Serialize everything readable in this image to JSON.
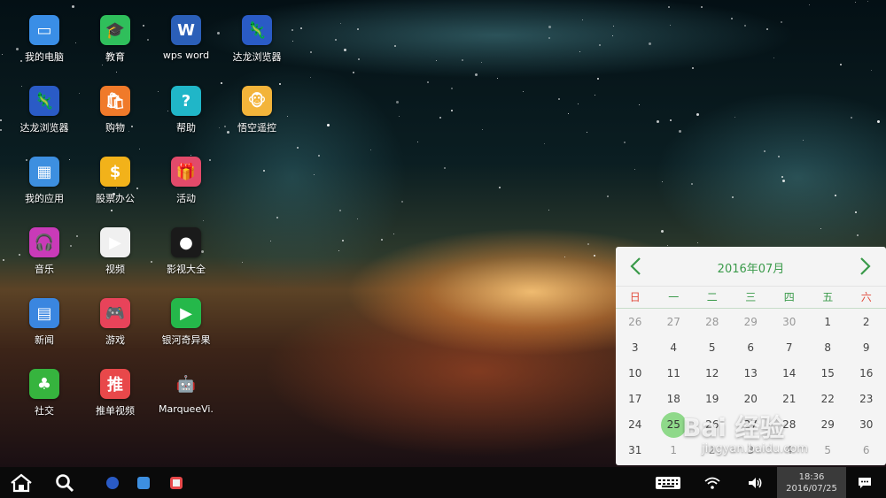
{
  "desktop": {
    "apps": [
      {
        "label": "我的电脑",
        "icon": "computer-icon",
        "color": "#3a8ee6",
        "glyph": "▭"
      },
      {
        "label": "教育",
        "icon": "graduation-cap-icon",
        "color": "#2fbf5b",
        "glyph": "🎓"
      },
      {
        "label": "wps word",
        "icon": "word-document-icon",
        "color": "#2b5fb8",
        "glyph": "W"
      },
      {
        "label": "达龙浏览器",
        "icon": "dalong-browser-icon",
        "color": "#2a5bc6",
        "glyph": "🦎"
      },
      {
        "label": "达龙浏览器",
        "icon": "dalong-browser-icon",
        "color": "#2a5bc6",
        "glyph": "🦎"
      },
      {
        "label": "购物",
        "icon": "shopping-bag-icon",
        "color": "#f07a2a",
        "glyph": "🛍"
      },
      {
        "label": "帮助",
        "icon": "help-icon",
        "color": "#20b6c8",
        "glyph": "?"
      },
      {
        "label": "悟空遥控",
        "icon": "monkey-remote-icon",
        "color": "#f3b43a",
        "glyph": "🐵"
      },
      {
        "label": "我的应用",
        "icon": "apps-grid-icon",
        "color": "#3d8fe0",
        "glyph": "▦"
      },
      {
        "label": "股票办公",
        "icon": "stock-coin-icon",
        "color": "#f2b21a",
        "glyph": "$"
      },
      {
        "label": "活动",
        "icon": "gift-icon",
        "color": "#e24a6a",
        "glyph": "🎁"
      },
      {
        "label": "",
        "icon": "blank-icon",
        "color": "transparent",
        "glyph": ""
      },
      {
        "label": "音乐",
        "icon": "music-icon",
        "color": "#c93ab8",
        "glyph": "🎧"
      },
      {
        "label": "视频",
        "icon": "video-play-icon",
        "color": "#f0f0f0",
        "glyph": "▶"
      },
      {
        "label": "影视大全",
        "icon": "movie-icon",
        "color": "#1a1a1a",
        "glyph": "●"
      },
      {
        "label": "",
        "icon": "blank-icon",
        "color": "transparent",
        "glyph": ""
      },
      {
        "label": "新闻",
        "icon": "news-icon",
        "color": "#3a86e0",
        "glyph": "▤"
      },
      {
        "label": "游戏",
        "icon": "gamepad-icon",
        "color": "#e8435a",
        "glyph": "🎮"
      },
      {
        "label": "银河奇异果",
        "icon": "tv-kiwi-icon",
        "color": "#25b84a",
        "glyph": "▶"
      },
      {
        "label": "",
        "icon": "blank-icon",
        "color": "transparent",
        "glyph": ""
      },
      {
        "label": "社交",
        "icon": "social-icon",
        "color": "#36b43e",
        "glyph": "♣"
      },
      {
        "label": "推单视频",
        "icon": "red-video-icon",
        "color": "#e8484a",
        "glyph": "推"
      },
      {
        "label": "MarqueeVi.",
        "icon": "android-icon",
        "color": "transparent",
        "glyph": "🤖"
      }
    ]
  },
  "calendar": {
    "title": "2016年07月",
    "weekdays": [
      "日",
      "一",
      "二",
      "三",
      "四",
      "五",
      "六"
    ],
    "weeks": [
      [
        "26",
        "27",
        "28",
        "29",
        "30",
        "1",
        "2"
      ],
      [
        "3",
        "4",
        "5",
        "6",
        "7",
        "8",
        "9"
      ],
      [
        "10",
        "11",
        "12",
        "13",
        "14",
        "15",
        "16"
      ],
      [
        "17",
        "18",
        "19",
        "20",
        "21",
        "22",
        "23"
      ],
      [
        "24",
        "25",
        "26",
        "27",
        "28",
        "29",
        "30"
      ],
      [
        "31",
        "1",
        "2",
        "3",
        "4",
        "5",
        "6"
      ]
    ],
    "today": "25",
    "accent_color": "#3a9a4a",
    "weekend_color": "#e24b3b"
  },
  "taskbar": {
    "time": "18:36",
    "date": "2016/07/25",
    "pinned": [
      "dalong-browser-icon",
      "apps-grid-icon",
      "video-play-icon"
    ]
  },
  "watermark": {
    "text": "Bai 经验",
    "url": "jingyan.baidu.com"
  }
}
